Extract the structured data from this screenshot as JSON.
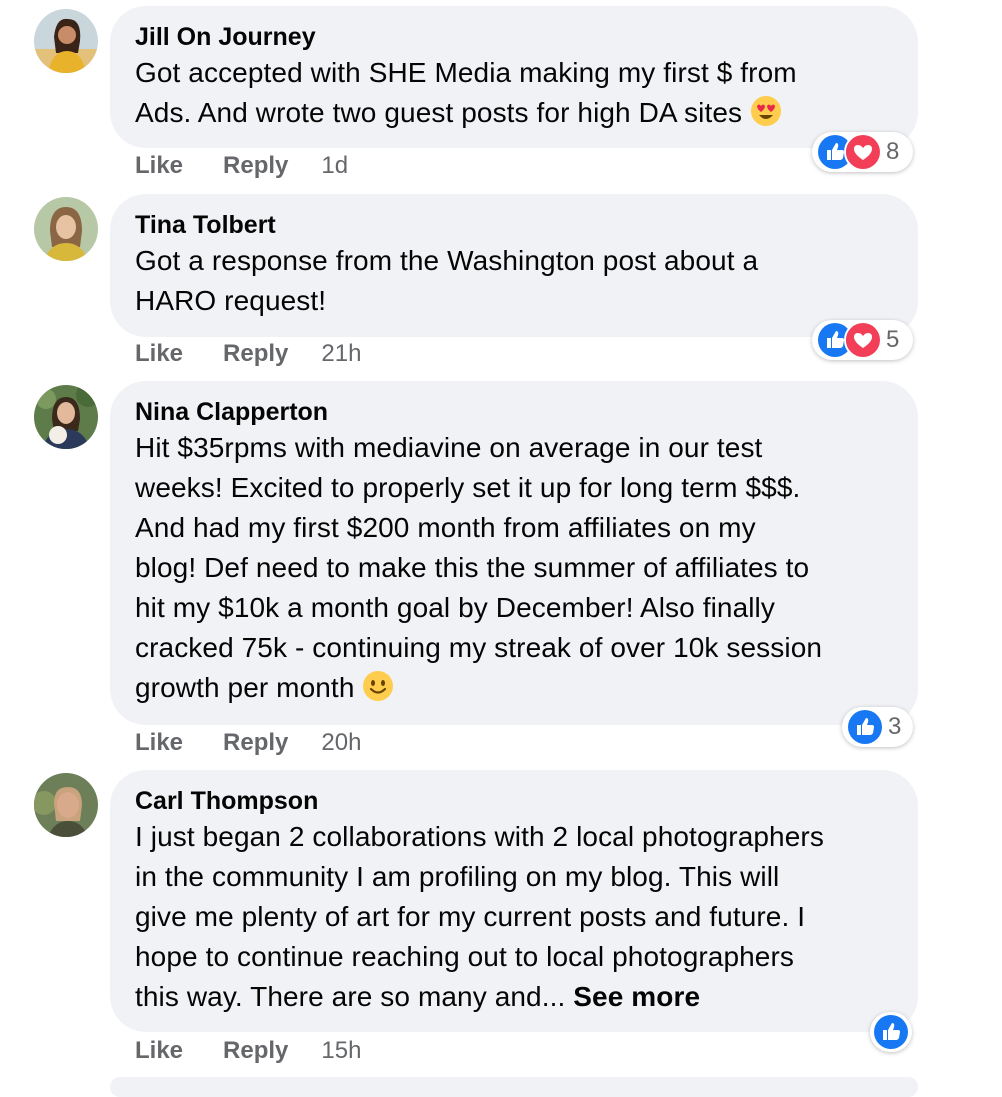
{
  "colors": {
    "bubble_bg": "#f0f2f5",
    "like_blue": "#1877f2",
    "love_red": "#f33e58",
    "meta_text": "#65676b"
  },
  "comments": [
    {
      "author": "Jill On Journey",
      "lines": [
        "Got accepted with SHE Media making my first $ from",
        "Ads. And wrote two guest posts for high DA sites"
      ],
      "emoji": "heart-eyes-emoji",
      "like_label": "Like",
      "reply_label": "Reply",
      "time": "1d",
      "reactions": [
        "like",
        "love"
      ],
      "reaction_count": "8"
    },
    {
      "author": "Tina Tolbert",
      "lines": [
        "Got a response from the Washington post about a",
        "HARO request!"
      ],
      "like_label": "Like",
      "reply_label": "Reply",
      "time": "21h",
      "reactions": [
        "like",
        "love"
      ],
      "reaction_count": "5"
    },
    {
      "author": "Nina Clapperton",
      "lines": [
        "Hit $35rpms with mediavine on average in our test",
        "weeks! Excited to properly set it up for long term $$$.",
        "And had my first $200 month from affiliates on my",
        "blog! Def need to make this the summer of affiliates to",
        "hit my $10k a month goal by December! Also finally",
        "cracked 75k - continuing my streak of over 10k session",
        "growth per month"
      ],
      "emoji": "smiling-face-emoji",
      "like_label": "Like",
      "reply_label": "Reply",
      "time": "20h",
      "reactions": [
        "like"
      ],
      "reaction_count": "3"
    },
    {
      "author": "Carl Thompson",
      "lines": [
        "I just began 2 collaborations with 2 local photographers",
        "in the community I am profiling on my blog. This will",
        "give me plenty of art for my current posts and future. I",
        "hope to continue reaching out to local photographers",
        "this way. There are so many and..."
      ],
      "see_more": "See more",
      "like_label": "Like",
      "reply_label": "Reply",
      "time": "15h",
      "reactions": [
        "like"
      ]
    }
  ]
}
